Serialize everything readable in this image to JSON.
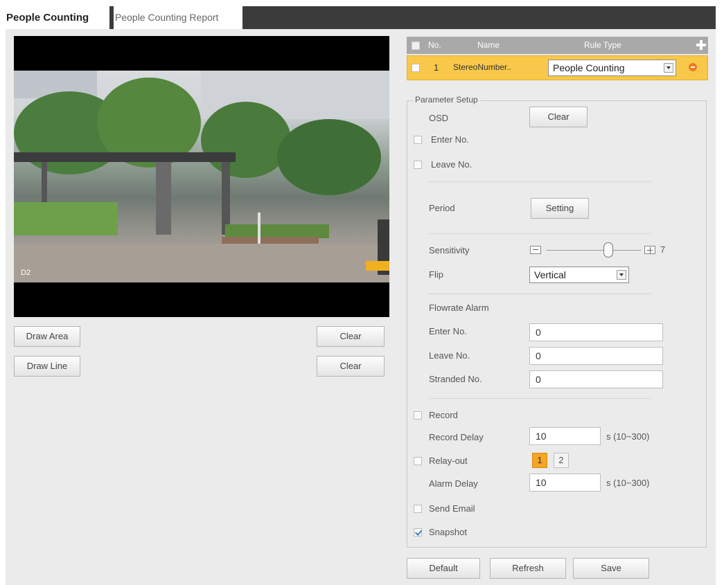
{
  "tabs": {
    "active": "People Counting",
    "inactive": "People Counting Report"
  },
  "video": {
    "channel_label": "D2"
  },
  "left_buttons": {
    "draw_area": "Draw Area",
    "draw_line": "Draw Line",
    "clear_area": "Clear",
    "clear_line": "Clear"
  },
  "rules": {
    "headers": {
      "no": "No.",
      "name": "Name",
      "rule_type": "Rule Type"
    },
    "rows": [
      {
        "no": "1",
        "name": "StereoNumber..",
        "rule_type": "People Counting"
      }
    ]
  },
  "param": {
    "legend": "Parameter Setup",
    "osd_label": "OSD",
    "osd_clear": "Clear",
    "enter_no_label": "Enter No.",
    "leave_no_label": "Leave No.",
    "period_label": "Period",
    "period_button": "Setting",
    "sensitivity_label": "Sensitivity",
    "sensitivity_value": "7",
    "flip_label": "Flip",
    "flip_value": "Vertical",
    "flowrate_label": "Flowrate Alarm",
    "flow_enter_label": "Enter No.",
    "flow_enter_value": "0",
    "flow_leave_label": "Leave No.",
    "flow_leave_value": "0",
    "stranded_label": "Stranded No.",
    "stranded_value": "0",
    "record_label": "Record",
    "record_delay_label": "Record Delay",
    "record_delay_value": "10",
    "record_delay_unit": "s (10~300)",
    "relay_label": "Relay-out",
    "relay_1": "1",
    "relay_2": "2",
    "alarm_delay_label": "Alarm Delay",
    "alarm_delay_value": "10",
    "alarm_delay_unit": "s (10~300)",
    "send_email_label": "Send Email",
    "snapshot_label": "Snapshot"
  },
  "footer": {
    "default": "Default",
    "refresh": "Refresh",
    "save": "Save"
  },
  "colors": {
    "rule_row_bg": "#f8c84a",
    "relay_active": "#f5a623",
    "tab_bar": "#3b3b3b"
  }
}
